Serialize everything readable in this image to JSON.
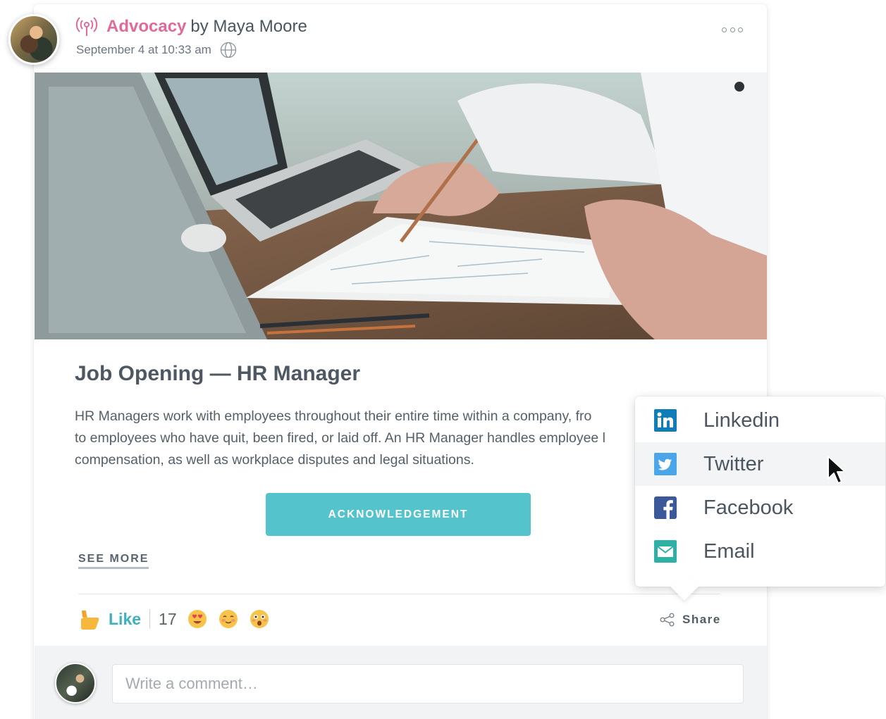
{
  "post": {
    "source": "Advocacy",
    "author_text": "by Maya Moore",
    "timestamp": "September 4 at 10:33 am",
    "title": "Job Opening — HR Manager",
    "body": "HR Managers work with employees throughout their entire time within a company, fro\nto employees who have quit, been fired, or laid off. An HR Manager handles employee l\ncompensation, as well as workplace disputes and legal situations.",
    "cta_label": "ACKNOWLEDGEMENT",
    "see_more_label": "SEE MORE"
  },
  "reactions": {
    "like_label": "Like",
    "count": "17",
    "emojis": [
      "heart-eyes-emoji",
      "blushing-emoji",
      "astonished-emoji"
    ]
  },
  "share": {
    "label": "Share",
    "menu": [
      {
        "label": "Linkedin",
        "icon": "linkedin-icon",
        "color": "#0e7db8"
      },
      {
        "label": "Twitter",
        "icon": "twitter-icon",
        "color": "#4aa6e9"
      },
      {
        "label": "Facebook",
        "icon": "facebook-icon",
        "color": "#3b5898"
      },
      {
        "label": "Email",
        "icon": "email-icon",
        "color": "#2fb0a5"
      }
    ]
  },
  "comment": {
    "placeholder": "Write a comment…"
  },
  "colors": {
    "brand_pink": "#e06a9a",
    "accent_teal": "#55c3cb",
    "like_teal": "#3fb1bb"
  }
}
